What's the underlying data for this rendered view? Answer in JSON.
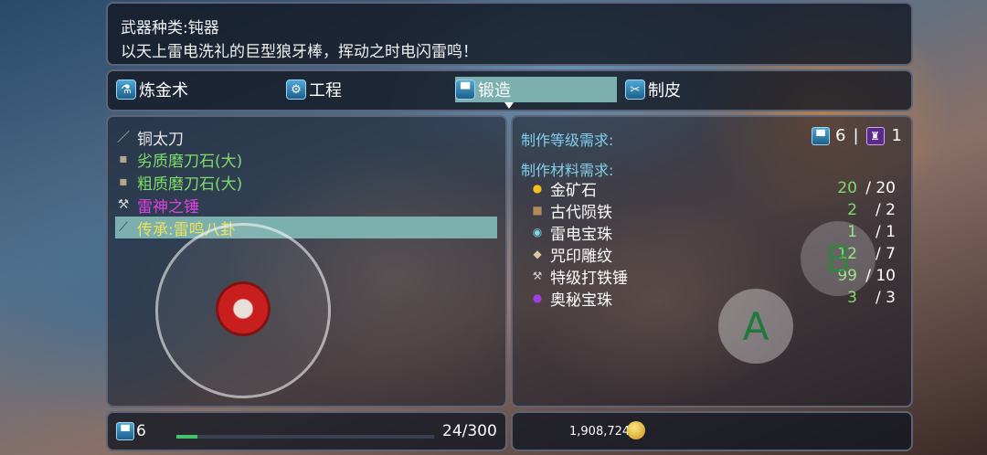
{
  "description": {
    "line1": "武器种类:钝器",
    "line2": "以天上雷电洗礼的巨型狼牙棒，挥动之时电闪雷鸣！"
  },
  "tabs": [
    {
      "label": "炼金术",
      "icon": "alchemy-icon"
    },
    {
      "label": "工程",
      "icon": "engineering-icon"
    },
    {
      "label": "锻造",
      "icon": "anvil-icon",
      "active": true
    },
    {
      "label": "制皮",
      "icon": "leather-icon"
    }
  ],
  "recipes": [
    {
      "label": "铜太刀",
      "color": "#e8e8e8",
      "icon": "sword-icon"
    },
    {
      "label": "劣质磨刀石(大)",
      "color": "#7ddc6a",
      "icon": "whetstone-icon"
    },
    {
      "label": "粗质磨刀石(大)",
      "color": "#7ddc6a",
      "icon": "whetstone-icon"
    },
    {
      "label": "雷神之锤",
      "color": "#e040e0",
      "icon": "hammer-icon"
    },
    {
      "label": "传承:雷鸣八卦",
      "color": "#f0e05a",
      "icon": "staff-icon",
      "selected": true
    }
  ],
  "requirements": {
    "level_title": "制作等级需求:",
    "level_value": "6",
    "separator": "|",
    "rank_value": "1",
    "materials_title": "制作材料需求:",
    "materials": [
      {
        "name": "金矿石",
        "have": "20",
        "need": "/ 20",
        "icon": "gold-ore-icon"
      },
      {
        "name": "古代陨铁",
        "have": "2",
        "need": "/ 2",
        "icon": "meteor-iron-icon"
      },
      {
        "name": "雷电宝珠",
        "have": "1",
        "need": "/ 1",
        "icon": "thunder-orb-icon"
      },
      {
        "name": "咒印雕纹",
        "have": "12",
        "need": "/ 7",
        "icon": "rune-icon"
      },
      {
        "name": "特级打铁锤",
        "have": "99",
        "need": "/ 10",
        "icon": "smith-hammer-icon"
      },
      {
        "name": "奥秘宝珠",
        "have": "3",
        "need": "/ 3",
        "icon": "mystic-orb-icon"
      }
    ]
  },
  "footer": {
    "level": "6",
    "progress_text": "24/300",
    "progress": 0.08,
    "gold": "1,908,724"
  },
  "controls": {
    "a_label": "A",
    "b_label": "B"
  },
  "colors": {
    "accent": "#7cb0ae",
    "header": "#7fd0e8",
    "have": "#7ddc6a"
  }
}
